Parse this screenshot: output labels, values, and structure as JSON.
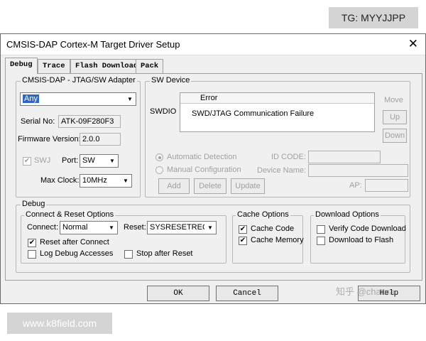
{
  "watermarks": {
    "top": "TG: MYYJJPP",
    "bottom": "www.k8field.com",
    "zhihu": "知乎 @chaura"
  },
  "window": {
    "title": "CMSIS-DAP Cortex-M Target Driver Setup",
    "close_glyph": "✕"
  },
  "tabs": [
    {
      "label": "Debug",
      "active": true
    },
    {
      "label": "Trace",
      "active": false
    },
    {
      "label": "Flash Download",
      "active": false
    },
    {
      "label": "Pack",
      "active": false
    }
  ],
  "adapter": {
    "title": "CMSIS-DAP - JTAG/SW Adapter",
    "selected": "Any",
    "serial_label": "Serial No:",
    "serial_value": "ATK-09F280F3",
    "firmware_label": "Firmware Version:",
    "firmware_value": "2.0.0",
    "swj_label": "SWJ",
    "swj_checked": true,
    "port_label": "Port:",
    "port_value": "SW",
    "maxclock_label": "Max Clock:",
    "maxclock_value": "10MHz"
  },
  "sw_device": {
    "title": "SW Device",
    "swdio_label": "SWDIO",
    "col_header": "Error",
    "row_value": "SWD/JTAG Communication Failure",
    "move_label": "Move",
    "up_label": "Up",
    "down_label": "Down",
    "auto_detect": "Automatic Detection",
    "manual_config": "Manual Configuration",
    "idcode_label": "ID CODE:",
    "device_name_label": "Device Name:",
    "ap_label": "AP:",
    "add": "Add",
    "delete": "Delete",
    "update": "Update"
  },
  "debug": {
    "title": "Debug",
    "connect_reset": {
      "title": "Connect & Reset Options",
      "connect_label": "Connect:",
      "connect_value": "Normal",
      "reset_label": "Reset:",
      "reset_value": "SYSRESETREQ",
      "reset_after_connect": "Reset after Connect",
      "reset_after_connect_checked": true,
      "log_debug": "Log Debug Accesses",
      "log_debug_checked": false,
      "stop_after_reset": "Stop after Reset",
      "stop_after_reset_checked": false
    },
    "cache": {
      "title": "Cache Options",
      "cache_code": "Cache Code",
      "cache_code_checked": true,
      "cache_memory": "Cache Memory",
      "cache_memory_checked": true
    },
    "download": {
      "title": "Download Options",
      "verify": "Verify Code Download",
      "verify_checked": false,
      "download_to_flash": "Download to Flash",
      "download_to_flash_checked": false
    }
  },
  "buttons": {
    "ok": "OK",
    "cancel": "Cancel",
    "help": "Help"
  },
  "glyphs": {
    "check": "✔",
    "dropdown": "▼"
  }
}
